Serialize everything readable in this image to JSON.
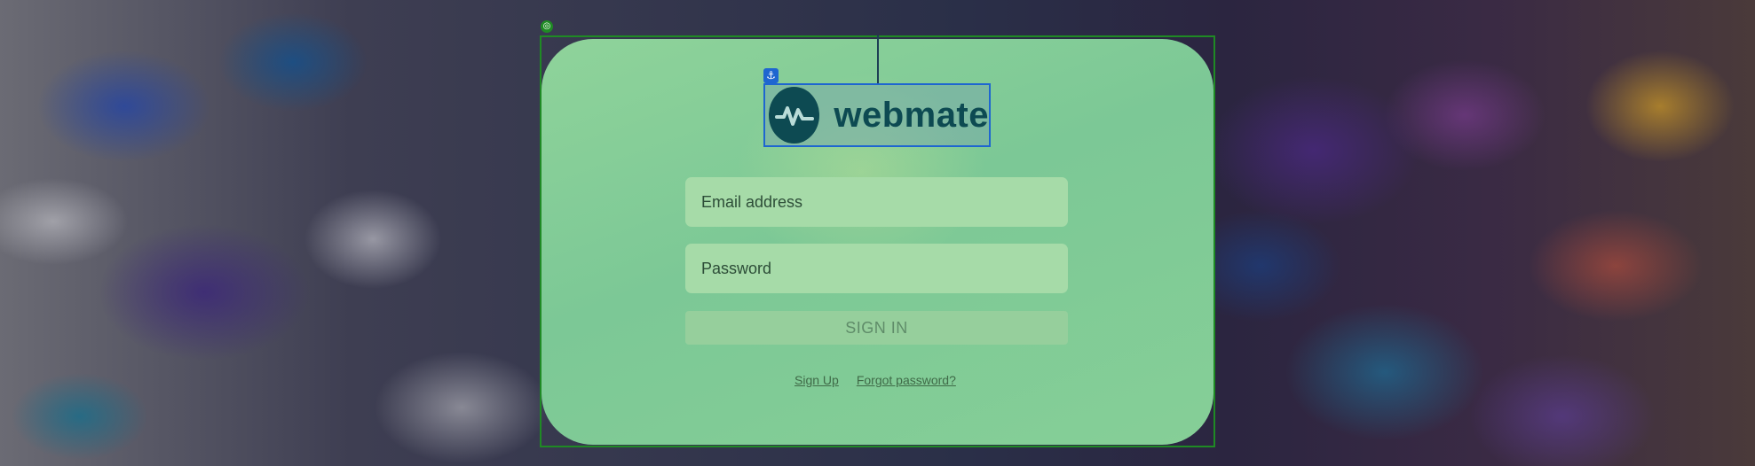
{
  "brand": {
    "name": "webmate"
  },
  "login": {
    "email_placeholder": "Email address",
    "password_placeholder": "Password",
    "signin_label": "SIGN IN",
    "signup_link": "Sign Up",
    "forgot_link": "Forgot password?"
  },
  "editor_overlay": {
    "frame_handle_icon": "target-icon",
    "anchor_icon": "anchor-icon",
    "frame_color": "#1f8a24",
    "selection_color": "#1e66d0"
  },
  "colors": {
    "card_bg": "#86cf97",
    "field_bg": "#a6dba8",
    "button_bg": "#96cf9c",
    "logo_color": "#0d4a52"
  }
}
